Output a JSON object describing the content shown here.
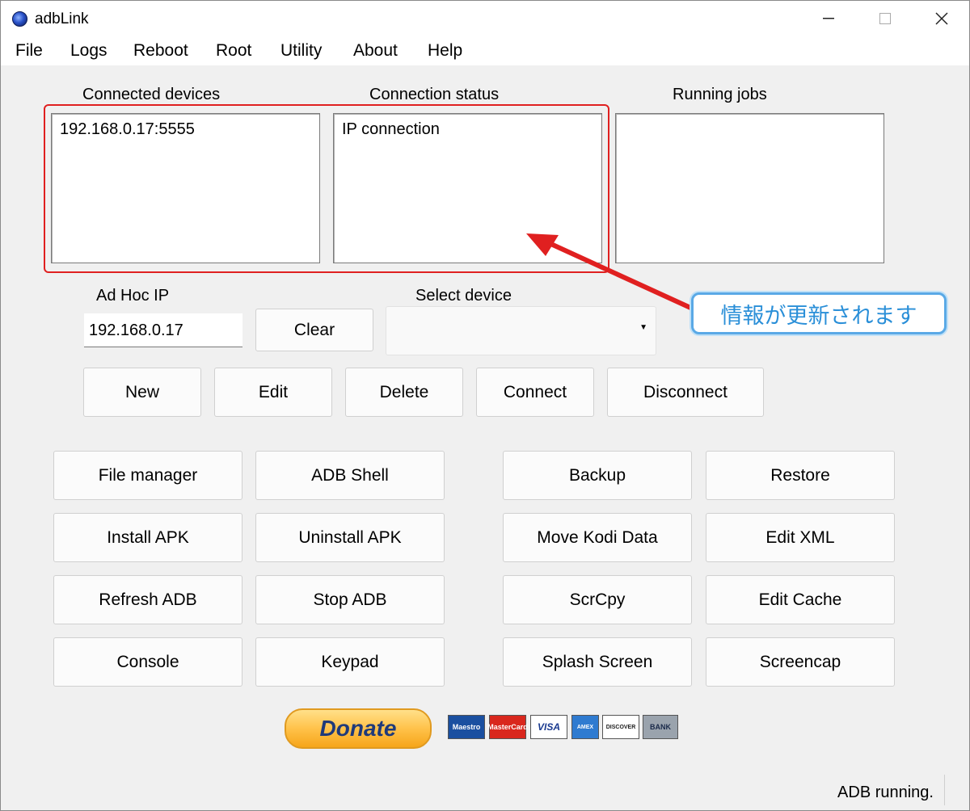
{
  "window": {
    "title": "adbLink"
  },
  "menu": [
    "File",
    "Logs",
    "Reboot",
    "Root",
    "Utility",
    "About",
    "Help"
  ],
  "panels": {
    "connected_devices": {
      "label": "Connected devices",
      "items": [
        "192.168.0.17:5555"
      ]
    },
    "connection_status": {
      "label": "Connection status",
      "items": [
        "IP connection"
      ]
    },
    "running_jobs": {
      "label": "Running jobs",
      "items": []
    }
  },
  "adhoc": {
    "label": "Ad Hoc IP",
    "value": "192.168.0.17",
    "clear_label": "Clear"
  },
  "select_device": {
    "label": "Select device",
    "value": ""
  },
  "device_buttons": [
    "New",
    "Edit",
    "Delete",
    "Connect",
    "Disconnect"
  ],
  "action_buttons_left": [
    [
      "File manager",
      "ADB Shell"
    ],
    [
      "Install APK",
      "Uninstall APK"
    ],
    [
      "Refresh ADB",
      "Stop ADB"
    ],
    [
      "Console",
      "Keypad"
    ]
  ],
  "action_buttons_right": [
    [
      "Backup",
      "Restore"
    ],
    [
      "Move Kodi Data",
      "Edit XML"
    ],
    [
      "ScrCpy",
      "Edit Cache"
    ],
    [
      "Splash Screen",
      "Screencap"
    ]
  ],
  "donate": {
    "label": "Donate",
    "cards": [
      "Maestro",
      "MasterCard",
      "VISA",
      "AMEX",
      "DISCOVER",
      "BANK"
    ]
  },
  "annotation": {
    "text": "情報が更新されます",
    "color": "#2a8fd8",
    "highlight_color": "#e02020"
  },
  "statusbar": {
    "text": "ADB running."
  }
}
